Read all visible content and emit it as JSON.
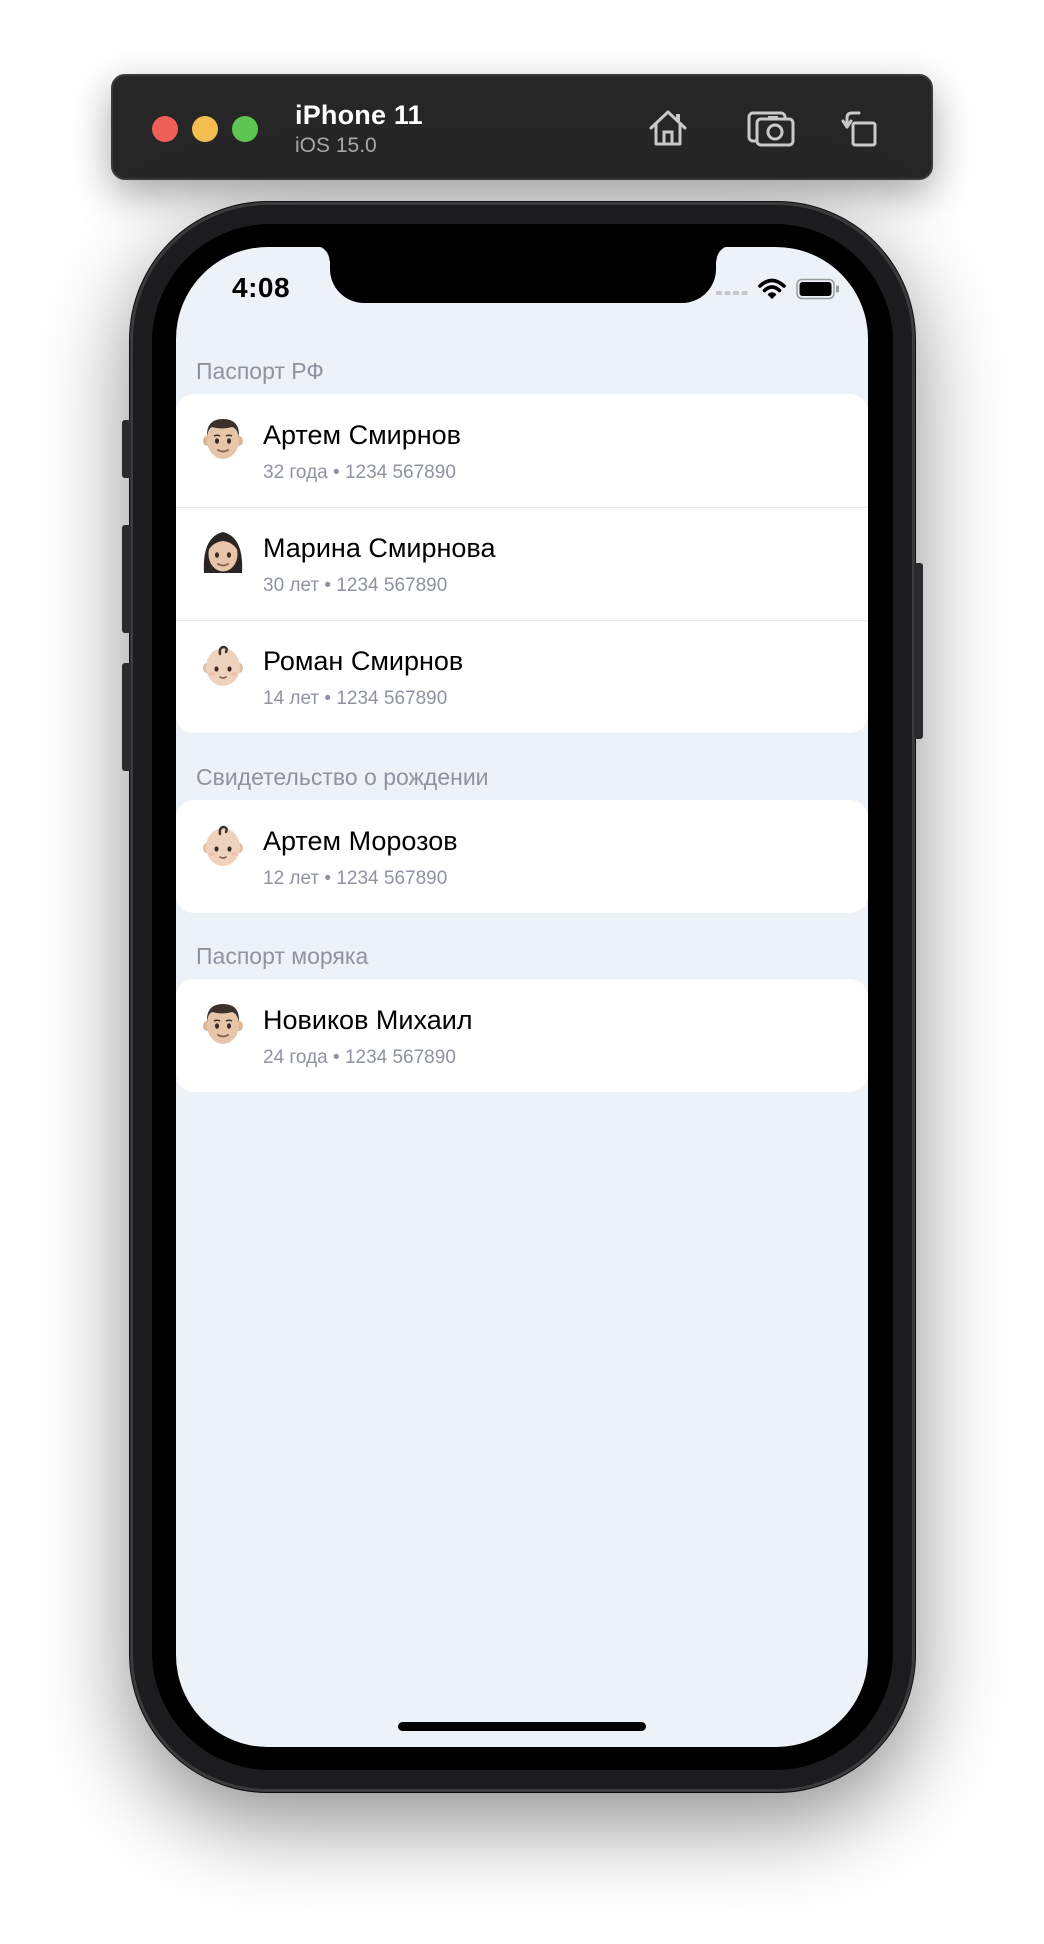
{
  "simulator": {
    "device_name": "iPhone 11",
    "os_version": "iOS 15.0",
    "buttons": {
      "home": "home-icon",
      "screenshot": "screenshot-icon",
      "rotate": "rotate-icon"
    }
  },
  "status_bar": {
    "time": "4:08",
    "icons": [
      "cellular-icon",
      "wifi-icon",
      "battery-icon"
    ]
  },
  "sections": [
    {
      "header": "Паспорт РФ",
      "items": [
        {
          "name": "Артем Смирнов",
          "details": "32 года • 1234 567890",
          "avatar": "man-emoji-icon"
        },
        {
          "name": "Марина Смирнова",
          "details": "30 лет • 1234 567890",
          "avatar": "woman-emoji-icon"
        },
        {
          "name": "Роман Смирнов",
          "details": "14 лет • 1234 567890",
          "avatar": "baby-emoji-icon"
        }
      ]
    },
    {
      "header": "Свидетельство о рождении",
      "items": [
        {
          "name": "Артем Морозов",
          "details": "12 лет • 1234 567890",
          "avatar": "baby-emoji-icon"
        }
      ]
    },
    {
      "header": "Паспорт моряка",
      "items": [
        {
          "name": "Новиков Михаил",
          "details": "24 года • 1234 567890",
          "avatar": "man-emoji-icon"
        }
      ]
    }
  ],
  "colors": {
    "screen_background": "#edf1f8",
    "card_background": "#ffffff",
    "secondary_text": "#8d93a0",
    "toolbar_background": "#262626"
  }
}
